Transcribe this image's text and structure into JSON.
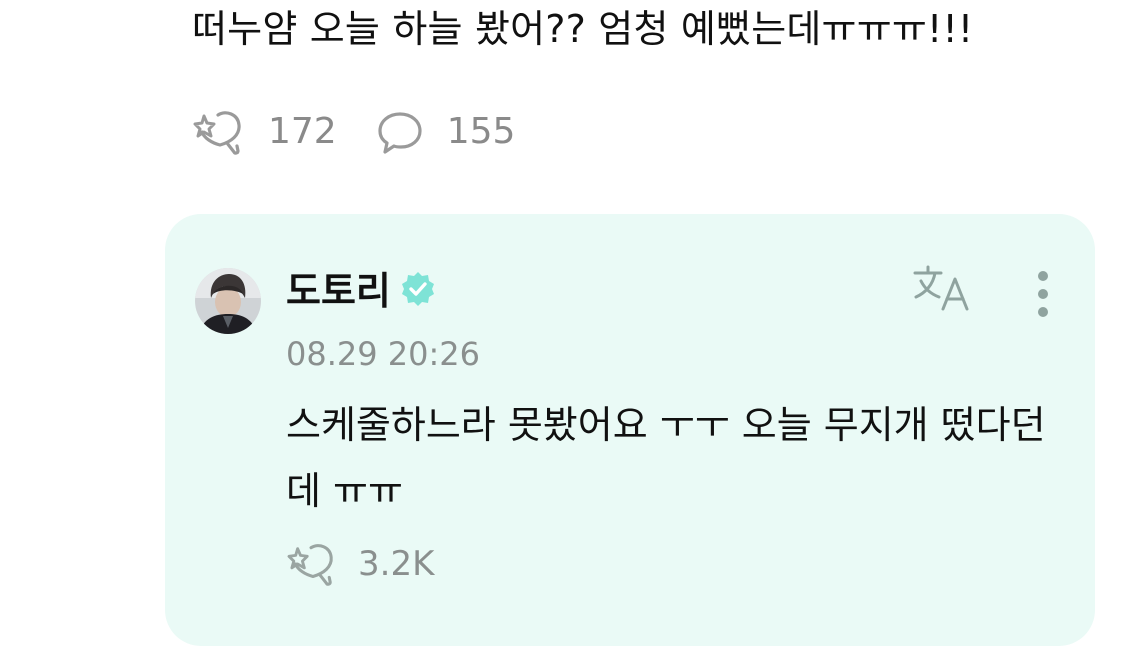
{
  "post": {
    "text": "떠누얌 오늘 하늘 봤어?? 엄청 예뻤는데ㅠㅠㅠ!!!",
    "like_icon": "sparkle-heart-icon",
    "like_count": "172",
    "comment_icon": "speech-bubble-icon",
    "comment_count": "155"
  },
  "reply": {
    "author_name": "도토리",
    "verified_icon": "verified-badge-icon",
    "timestamp": "08.29 20:26",
    "body": "스케줄하느라 못봤어요 ㅜㅜ 오늘 무지개 떴다던데 ㅠㅠ",
    "translate_icon": "translate-icon",
    "more_icon": "more-vertical-icon",
    "like_icon": "sparkle-heart-icon",
    "like_count": "3.2K"
  },
  "colors": {
    "reply_background": "#eafaf6",
    "verified_badge": "#7ee3d6",
    "muted_text": "#8a8a8a",
    "icon_gray": "#9a9a9a"
  }
}
